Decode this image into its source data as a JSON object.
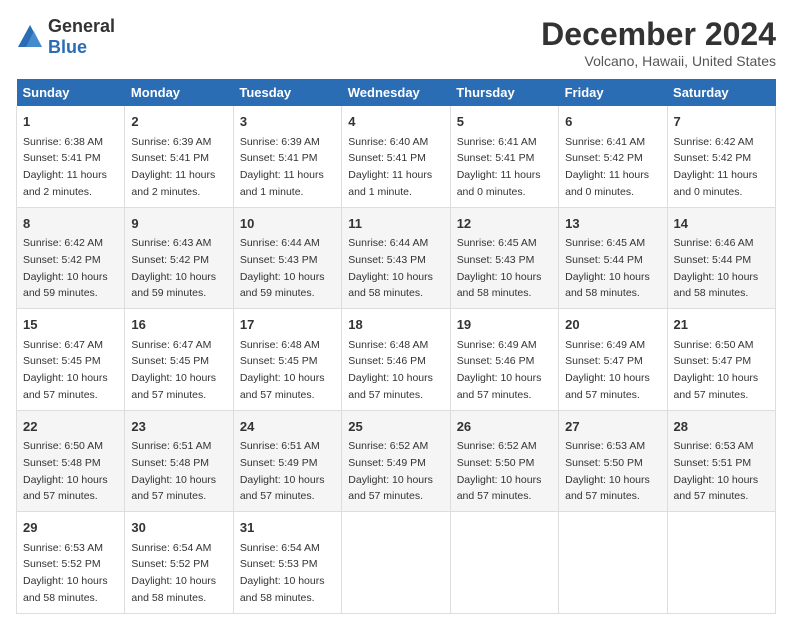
{
  "header": {
    "logo_general": "General",
    "logo_blue": "Blue",
    "title": "December 2024",
    "subtitle": "Volcano, Hawaii, United States"
  },
  "weekdays": [
    "Sunday",
    "Monday",
    "Tuesday",
    "Wednesday",
    "Thursday",
    "Friday",
    "Saturday"
  ],
  "weeks": [
    [
      {
        "day": "1",
        "sunrise": "6:38 AM",
        "sunset": "5:41 PM",
        "daylight": "11 hours and 2 minutes."
      },
      {
        "day": "2",
        "sunrise": "6:39 AM",
        "sunset": "5:41 PM",
        "daylight": "11 hours and 2 minutes."
      },
      {
        "day": "3",
        "sunrise": "6:39 AM",
        "sunset": "5:41 PM",
        "daylight": "11 hours and 1 minute."
      },
      {
        "day": "4",
        "sunrise": "6:40 AM",
        "sunset": "5:41 PM",
        "daylight": "11 hours and 1 minute."
      },
      {
        "day": "5",
        "sunrise": "6:41 AM",
        "sunset": "5:41 PM",
        "daylight": "11 hours and 0 minutes."
      },
      {
        "day": "6",
        "sunrise": "6:41 AM",
        "sunset": "5:42 PM",
        "daylight": "11 hours and 0 minutes."
      },
      {
        "day": "7",
        "sunrise": "6:42 AM",
        "sunset": "5:42 PM",
        "daylight": "11 hours and 0 minutes."
      }
    ],
    [
      {
        "day": "8",
        "sunrise": "6:42 AM",
        "sunset": "5:42 PM",
        "daylight": "10 hours and 59 minutes."
      },
      {
        "day": "9",
        "sunrise": "6:43 AM",
        "sunset": "5:42 PM",
        "daylight": "10 hours and 59 minutes."
      },
      {
        "day": "10",
        "sunrise": "6:44 AM",
        "sunset": "5:43 PM",
        "daylight": "10 hours and 59 minutes."
      },
      {
        "day": "11",
        "sunrise": "6:44 AM",
        "sunset": "5:43 PM",
        "daylight": "10 hours and 58 minutes."
      },
      {
        "day": "12",
        "sunrise": "6:45 AM",
        "sunset": "5:43 PM",
        "daylight": "10 hours and 58 minutes."
      },
      {
        "day": "13",
        "sunrise": "6:45 AM",
        "sunset": "5:44 PM",
        "daylight": "10 hours and 58 minutes."
      },
      {
        "day": "14",
        "sunrise": "6:46 AM",
        "sunset": "5:44 PM",
        "daylight": "10 hours and 58 minutes."
      }
    ],
    [
      {
        "day": "15",
        "sunrise": "6:47 AM",
        "sunset": "5:45 PM",
        "daylight": "10 hours and 57 minutes."
      },
      {
        "day": "16",
        "sunrise": "6:47 AM",
        "sunset": "5:45 PM",
        "daylight": "10 hours and 57 minutes."
      },
      {
        "day": "17",
        "sunrise": "6:48 AM",
        "sunset": "5:45 PM",
        "daylight": "10 hours and 57 minutes."
      },
      {
        "day": "18",
        "sunrise": "6:48 AM",
        "sunset": "5:46 PM",
        "daylight": "10 hours and 57 minutes."
      },
      {
        "day": "19",
        "sunrise": "6:49 AM",
        "sunset": "5:46 PM",
        "daylight": "10 hours and 57 minutes."
      },
      {
        "day": "20",
        "sunrise": "6:49 AM",
        "sunset": "5:47 PM",
        "daylight": "10 hours and 57 minutes."
      },
      {
        "day": "21",
        "sunrise": "6:50 AM",
        "sunset": "5:47 PM",
        "daylight": "10 hours and 57 minutes."
      }
    ],
    [
      {
        "day": "22",
        "sunrise": "6:50 AM",
        "sunset": "5:48 PM",
        "daylight": "10 hours and 57 minutes."
      },
      {
        "day": "23",
        "sunrise": "6:51 AM",
        "sunset": "5:48 PM",
        "daylight": "10 hours and 57 minutes."
      },
      {
        "day": "24",
        "sunrise": "6:51 AM",
        "sunset": "5:49 PM",
        "daylight": "10 hours and 57 minutes."
      },
      {
        "day": "25",
        "sunrise": "6:52 AM",
        "sunset": "5:49 PM",
        "daylight": "10 hours and 57 minutes."
      },
      {
        "day": "26",
        "sunrise": "6:52 AM",
        "sunset": "5:50 PM",
        "daylight": "10 hours and 57 minutes."
      },
      {
        "day": "27",
        "sunrise": "6:53 AM",
        "sunset": "5:50 PM",
        "daylight": "10 hours and 57 minutes."
      },
      {
        "day": "28",
        "sunrise": "6:53 AM",
        "sunset": "5:51 PM",
        "daylight": "10 hours and 57 minutes."
      }
    ],
    [
      {
        "day": "29",
        "sunrise": "6:53 AM",
        "sunset": "5:52 PM",
        "daylight": "10 hours and 58 minutes."
      },
      {
        "day": "30",
        "sunrise": "6:54 AM",
        "sunset": "5:52 PM",
        "daylight": "10 hours and 58 minutes."
      },
      {
        "day": "31",
        "sunrise": "6:54 AM",
        "sunset": "5:53 PM",
        "daylight": "10 hours and 58 minutes."
      },
      null,
      null,
      null,
      null
    ]
  ],
  "labels": {
    "sunrise": "Sunrise:",
    "sunset": "Sunset:",
    "daylight": "Daylight:"
  }
}
